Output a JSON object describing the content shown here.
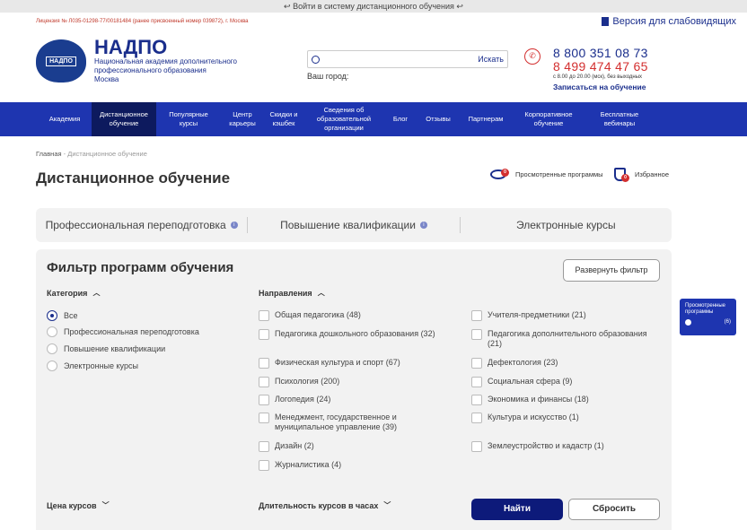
{
  "topbar": {
    "login": "↩ Войти в систему дистанционного обучения ↩"
  },
  "license": "Лицензия № Л035-01298-77/00181484 (ранее присвоенный номер 039872), г. Москва",
  "vision": "Версия для слабовидящих",
  "logo_text": "НАДПО",
  "brand": {
    "name": "НАДПО",
    "line1": "Национальная академия дополнительного",
    "line2": "профессионального образования",
    "city": "Москва"
  },
  "search": {
    "placeholder": "",
    "button": "Искать",
    "city_label": "Ваш город:"
  },
  "phones": {
    "p1": "8 800 351 08 73",
    "p2": "8 499 474 47 65",
    "hours": "с 8.00 до 20.00 (мск), без выходных",
    "signup": "Записаться на обучение"
  },
  "nav": [
    "Академия",
    "Дистанционное обучение",
    "Популярные курсы",
    "Центр карьеры",
    "Скидки и кэшбек",
    "Сведения об образовательной организации",
    "Блог",
    "Отзывы",
    "Партнерам",
    "Корпоративное обучение",
    "Бесплатные вебинары"
  ],
  "breadcrumb": {
    "home": "Главная",
    "sep": "-",
    "current": "Дистанционное обучение"
  },
  "page_title": "Дистанционное обучение",
  "viewed": {
    "label": "Просмотренные программы",
    "count": "0"
  },
  "favorites": {
    "label": "Избранное",
    "count": "0"
  },
  "tabs": [
    "Профессиональная переподготовка",
    "Повышение квалификации",
    "Электронные курсы"
  ],
  "filter": {
    "title": "Фильтр программ обучения",
    "expand": "Развернуть фильтр",
    "category_label": "Категория",
    "categories": [
      "Все",
      "Профессиональная переподготовка",
      "Повышение квалификации",
      "Электронные курсы"
    ],
    "directions_label": "Направления",
    "directions_left": [
      "Общая педагогика (48)",
      "Педагогика дошкольного образования (32)",
      "Физическая культура и спорт (67)",
      "Психология (200)",
      "Логопедия (24)",
      "Менеджмент, государственное и муниципальное управление (39)",
      "Дизайн (2)",
      "Журналистика (4)"
    ],
    "directions_right": [
      "Учителя-предметники (21)",
      "Педагогика дополнительного образования (21)",
      "Дефектология (23)",
      "Социальная сфера (9)",
      "Экономика и финансы (18)",
      "Культура и искусство (1)",
      "Землеустройство и кадастр (1)"
    ],
    "price_label": "Цена курсов",
    "duration_label": "Длительность курсов в часах",
    "find": "Найти",
    "reset": "Сбросить"
  },
  "widget": {
    "label": "Просмотренные программы",
    "count": "(6)"
  }
}
